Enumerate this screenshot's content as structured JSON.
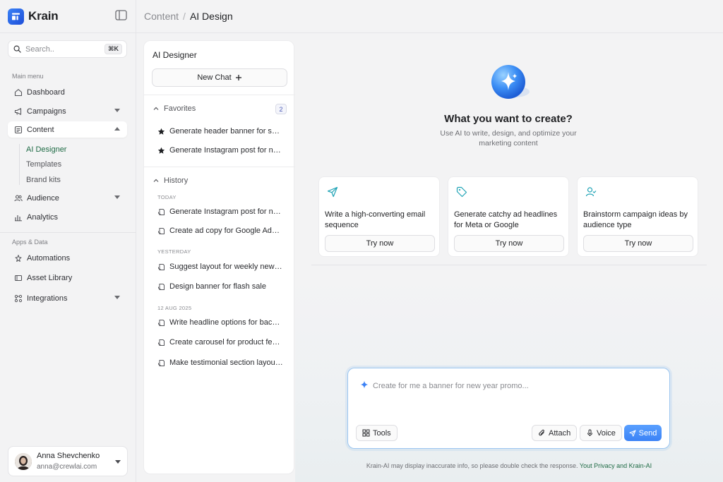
{
  "app": {
    "name": "Krain"
  },
  "search": {
    "placeholder": "Search..",
    "shortcut": "⌘K"
  },
  "sidebar": {
    "main_menu_label": "Main menu",
    "items": [
      {
        "label": "Dashboard",
        "icon": "home-icon"
      },
      {
        "label": "Campaigns",
        "icon": "megaphone-icon"
      },
      {
        "label": "Content",
        "icon": "document-icon"
      },
      {
        "label": "Audience",
        "icon": "users-icon"
      },
      {
        "label": "Analytics",
        "icon": "bar-chart-icon"
      }
    ],
    "content_sub": [
      "AI Designer",
      "Templates",
      "Brand kits"
    ],
    "apps_label": "Apps & Data",
    "apps": [
      {
        "label": "Automations",
        "icon": "automation-icon"
      },
      {
        "label": "Asset Library",
        "icon": "library-icon"
      },
      {
        "label": "Integrations",
        "icon": "integrations-icon"
      }
    ]
  },
  "user": {
    "name": "Anna Shevchenko",
    "email": "anna@crewlai.com"
  },
  "breadcrumb": {
    "parent": "Content",
    "separator": "/",
    "current": "AI Design"
  },
  "chat_panel": {
    "title": "AI Designer",
    "new_chat": "New Chat",
    "favorites_label": "Favorites",
    "favorites_count": "2",
    "favorites": [
      "Generate header banner for summer sale",
      "Generate Instagram post for new launch"
    ],
    "history_label": "History",
    "history_groups": [
      {
        "date": "TODAY",
        "items": [
          "Generate Instagram post for new product",
          "Create ad copy for Google Ads - spring"
        ]
      },
      {
        "date": "YESTERDAY",
        "items": [
          "Suggest layout for weekly newsletter",
          "Design banner for flash sale"
        ]
      },
      {
        "date": "12 AUG 2025",
        "items": [
          "Write headline options for back-to-school",
          "Create carousel for product features",
          "Make testimonial section layout ideas"
        ]
      }
    ]
  },
  "hero": {
    "title": "What you want to create?",
    "subtitle": "Use AI to write, design, and optimize your marketing content"
  },
  "cards": [
    {
      "icon": "paper-plane-icon",
      "text": "Write a high-converting email sequence",
      "cta": "Try now"
    },
    {
      "icon": "tag-icon",
      "text": "Generate catchy ad headlines for Meta or Google",
      "cta": "Try now"
    },
    {
      "icon": "user-check-icon",
      "text": "Brainstorm campaign ideas by audience type",
      "cta": "Try now"
    }
  ],
  "composer": {
    "placeholder": "Create for me a banner for new year promo...",
    "tools": "Tools",
    "attach": "Attach",
    "voice": "Voice",
    "send": "Send"
  },
  "disclaimer": {
    "text": "Krain-AI may display inaccurate info, so please double check the response.",
    "link": "Yout Privacy and Krain-AI"
  },
  "colors": {
    "accent": "#3b82f6",
    "active_green": "#1f6b45",
    "border": "#e4e4e7"
  }
}
